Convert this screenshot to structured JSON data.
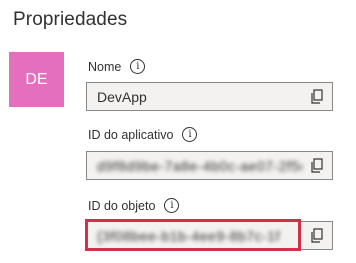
{
  "header": {
    "title": "Propriedades"
  },
  "avatar": {
    "initials": "DE",
    "color": "#e36fbe"
  },
  "fields": {
    "name": {
      "label": "Nome",
      "value": "DevApp"
    },
    "app_id": {
      "label": "ID do aplicativo",
      "value": "d9f8d9be-7a8e-4b0c-ae07-2f5c"
    },
    "object_id": {
      "label": "ID do objeto",
      "value": "{3f08bee-b1b-4ee9-8b7c-1f"
    }
  },
  "icons": {
    "info": "info-icon",
    "copy": "copy-icon"
  },
  "colors": {
    "highlight": "#d12f4a"
  }
}
